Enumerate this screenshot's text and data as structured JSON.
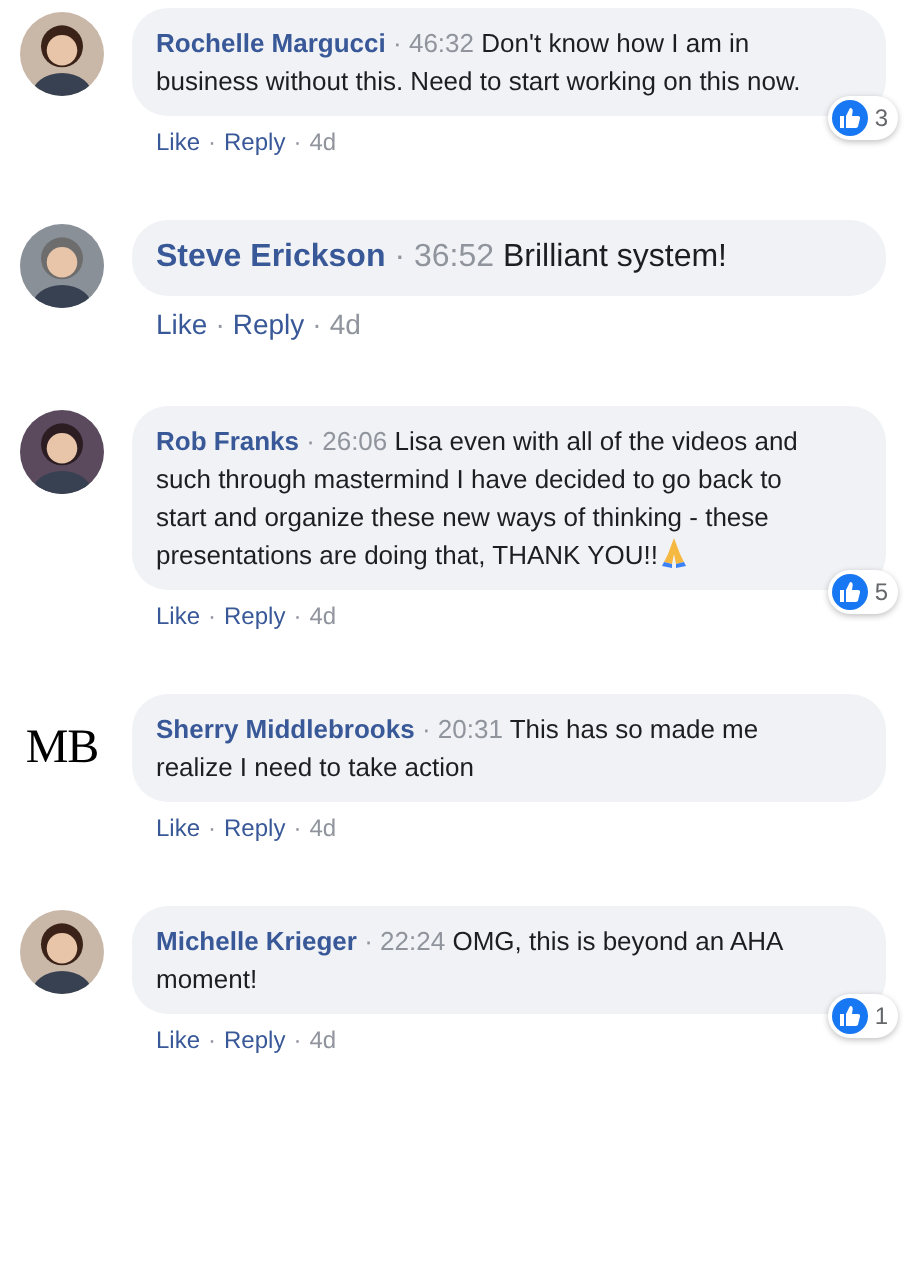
{
  "separator": "·",
  "comments": [
    {
      "name": "Rochelle Margucci",
      "time": "46:32",
      "text": "Don't know how I am in business without this. Need to start working on this now.",
      "kind": "normal",
      "emoji": false,
      "actions": [
        "Like",
        "Reply",
        "4d"
      ],
      "reactions": "3"
    },
    {
      "name": "Steve Erickson",
      "time": "36:52",
      "text": "Brilliant system!",
      "kind": "large",
      "emoji": false,
      "actions": [
        "Like",
        "Reply",
        "4d"
      ]
    },
    {
      "name": "Rob Franks",
      "time": "26:06",
      "text": "Lisa even with all of the videos and such through mastermind I have decided to go back to start and organize these new ways of thinking - these presentations are doing that, THANK YOU!!",
      "kind": "normal",
      "emoji": true,
      "actions": [
        "Like",
        "Reply",
        "4d"
      ],
      "reactions": "5"
    },
    {
      "avatar": {
        "kind": "initials",
        "text": "MB"
      },
      "name": "Sherry Middlebrooks",
      "time": "20:31",
      "text": "This has so made me realize I need to take action",
      "kind": "normal",
      "emoji": false,
      "actions": [
        "Like",
        "Reply",
        "4d"
      ]
    },
    {
      "name": "Michelle Krieger",
      "time": "22:24",
      "text": "OMG, this is beyond an AHA moment!",
      "kind": "normal",
      "emoji": false,
      "actions": [
        "Like",
        "Reply",
        "4d"
      ],
      "reactions": "1"
    }
  ]
}
